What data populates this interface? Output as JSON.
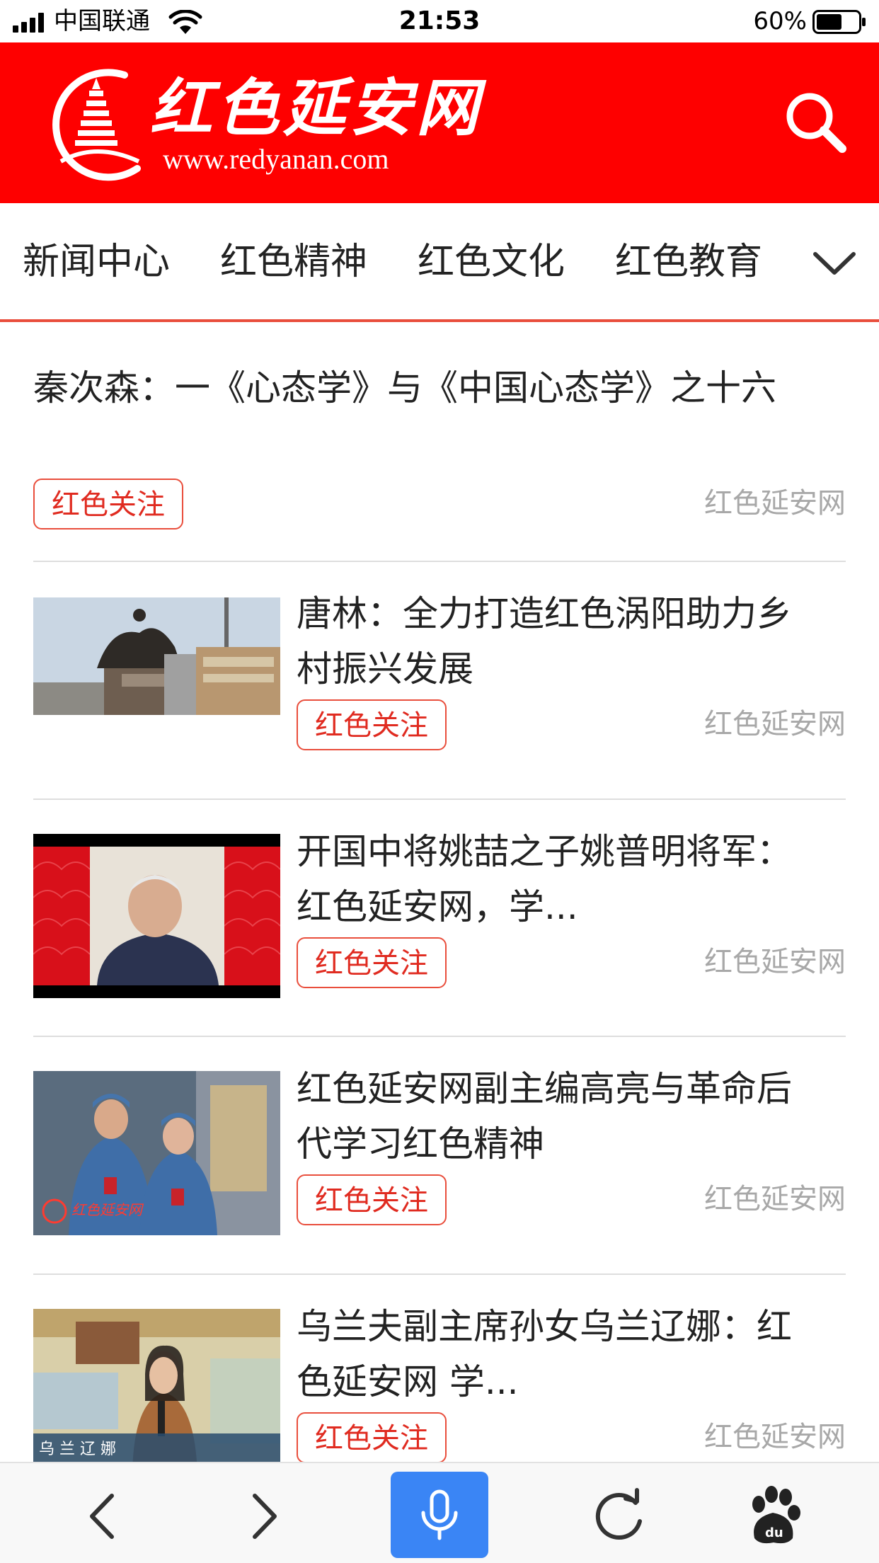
{
  "status_bar": {
    "carrier": "中国联通",
    "time": "21:53",
    "battery": "60%",
    "battery_level": 0.6
  },
  "header": {
    "logo_title": "红色延安网",
    "logo_url": "www.redyanan.com",
    "brand_color": "#fe0000"
  },
  "nav": {
    "items": [
      "新闻中心",
      "红色精神",
      "红色文化",
      "红色教育"
    ],
    "accent_color": "#e94e3c"
  },
  "feed": {
    "articles": [
      {
        "title": "秦次森：一《心态学》与《中国心态学》之十六",
        "tag": "红色关注",
        "source": "红色延安网"
      },
      {
        "title_line1": "唐林：全力打造红色涡阳助力乡",
        "title_line2": "村振兴发展",
        "tag": "红色关注",
        "source": "红色延安网"
      },
      {
        "title_line1": "开国中将姚喆之子姚普明将军：",
        "title_line2": "红色延安网，学...",
        "tag": "红色关注",
        "source": "红色延安网"
      },
      {
        "title_line1": "红色延安网副主编高亮与革命后",
        "title_line2": "代学习红色精神",
        "tag": "红色关注",
        "source": "红色延安网",
        "thumb_watermark": "红色延安网"
      },
      {
        "title_line1": "乌兰夫副主席孙女乌兰辽娜：红",
        "title_line2": "色延安网 学...",
        "tag": "红色关注",
        "source": "红色延安网",
        "thumb_caption": "乌 兰 辽 娜"
      }
    ]
  },
  "toolbar": {
    "icons": [
      "back-icon",
      "forward-icon",
      "microphone-icon",
      "refresh-icon",
      "baidu-paw-icon"
    ],
    "mic_color": "#3a85f5"
  }
}
